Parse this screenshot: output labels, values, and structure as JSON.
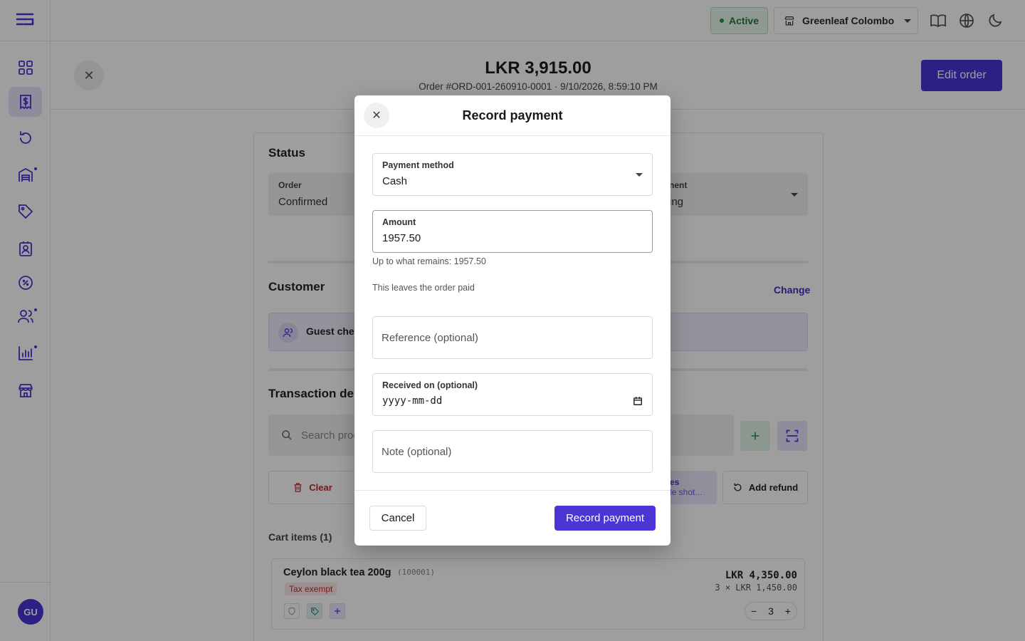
{
  "topbar": {
    "status": "Active",
    "store": "Greenleaf Colombo"
  },
  "sidebar": {
    "avatar_initials": "GU"
  },
  "order": {
    "total": "LKR 3,915.00",
    "subtitle": "Order #ORD-001-260910-0001 · 9/10/2026, 8:59:10 PM",
    "edit_label": "Edit order"
  },
  "status_section": {
    "title": "Status",
    "order_label": "Order",
    "order_value": "Confirmed",
    "payment_label": "nent",
    "payment_value": "ing"
  },
  "customer_section": {
    "title": "Customer",
    "change_label": "Change",
    "guest_text": "Guest che"
  },
  "transaction_section": {
    "title": "Transaction de",
    "search_placeholder": "Search prod",
    "clear_label": "Clear",
    "notes_line1": "es",
    "notes_line2": "de shot...",
    "refund_label": "Add refund"
  },
  "cart": {
    "label": "Cart items (1)",
    "item": {
      "name": "Ceylon black tea 200g",
      "sku": "(100001)",
      "tag": "Tax exempt",
      "price": "LKR 4,350.00",
      "unit_line": "3 × LKR 1,450.00",
      "qty": "3"
    }
  },
  "modal": {
    "title": "Record payment",
    "method_label": "Payment method",
    "method_value": "Cash",
    "amount_label": "Amount",
    "amount_value": "1957.50",
    "amount_helper": "Up to what remains: 1957.50",
    "paid_note": "This leaves the order paid",
    "reference_placeholder": "Reference (optional)",
    "received_label": "Received on (optional)",
    "received_placeholder": "yyyy-mm-dd",
    "note_placeholder": "Note (optional)",
    "cancel_label": "Cancel",
    "submit_label": "Record payment"
  },
  "colors": {
    "brand": "#4a35d6",
    "status_green": "#1f7a3a",
    "danger": "#c62828"
  }
}
